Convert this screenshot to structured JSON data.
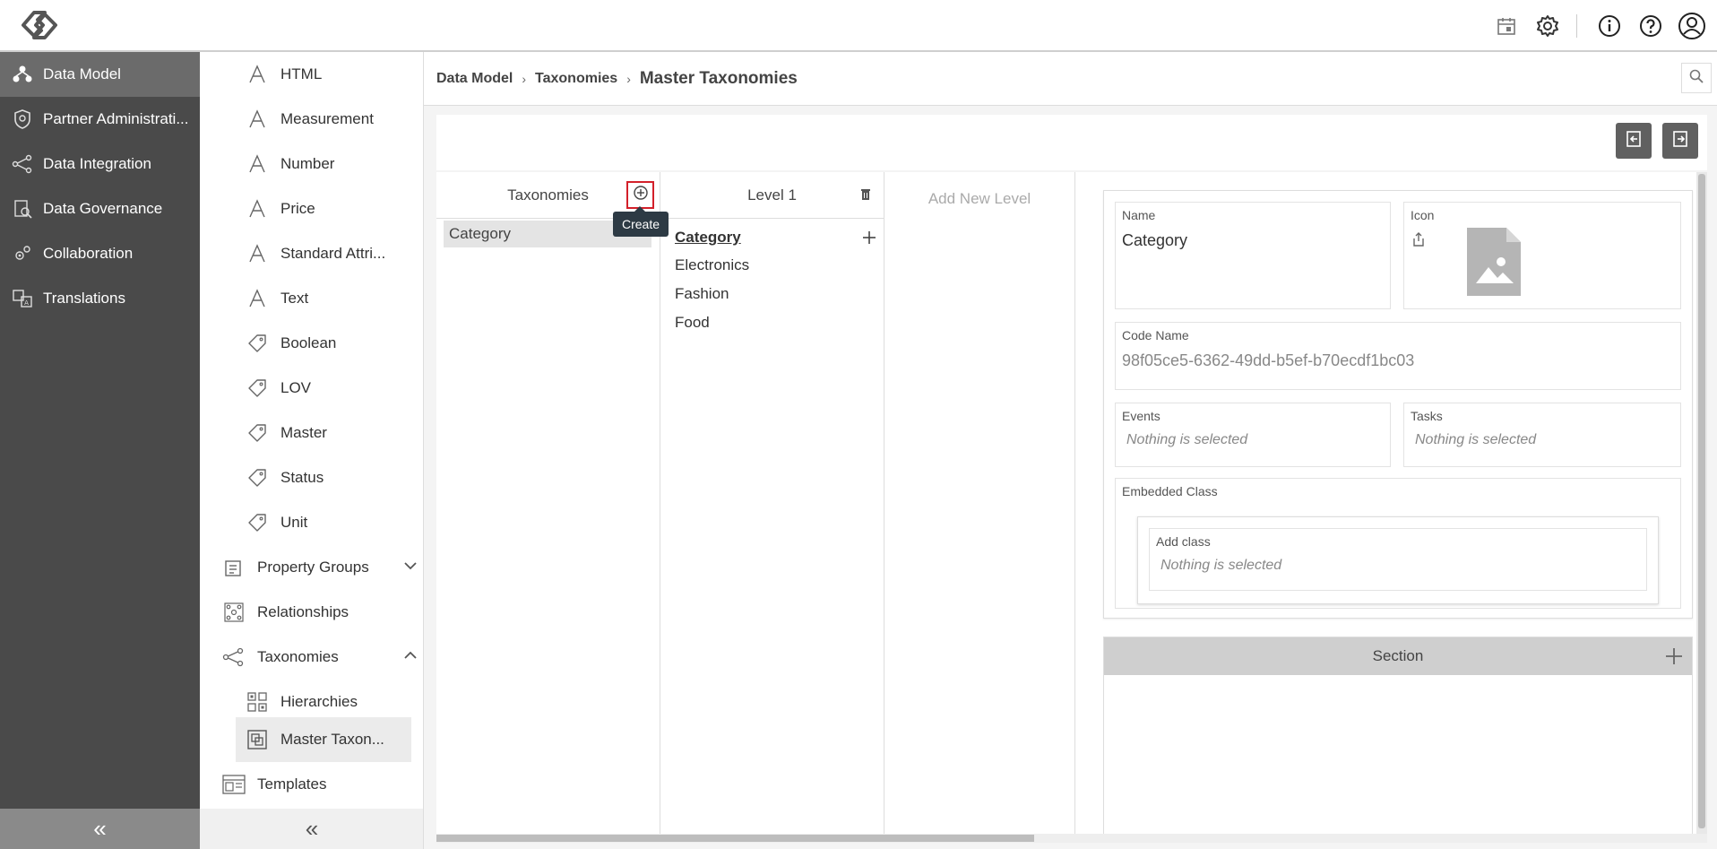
{
  "topbar": {
    "icons": [
      "calendar-icon",
      "gear-icon",
      "info-icon",
      "help-icon",
      "user-icon"
    ]
  },
  "leftnav": {
    "items": [
      {
        "label": "Data Model",
        "icon": "data-model-icon",
        "active": true
      },
      {
        "label": "Partner Administrati...",
        "icon": "shield-icon",
        "active": false
      },
      {
        "label": "Data Integration",
        "icon": "integration-icon",
        "active": false
      },
      {
        "label": "Data Governance",
        "icon": "governance-icon",
        "active": false
      },
      {
        "label": "Collaboration",
        "icon": "collaboration-icon",
        "active": false
      },
      {
        "label": "Translations",
        "icon": "translations-icon",
        "active": false
      }
    ],
    "collapse": "«"
  },
  "subnav": {
    "items": [
      {
        "label": "HTML",
        "icon": "attribute-a-icon"
      },
      {
        "label": "Measurement",
        "icon": "attribute-a-icon"
      },
      {
        "label": "Number",
        "icon": "attribute-a-icon"
      },
      {
        "label": "Price",
        "icon": "attribute-a-icon"
      },
      {
        "label": "Standard Attri...",
        "icon": "attribute-a-icon"
      },
      {
        "label": "Text",
        "icon": "attribute-a-icon"
      },
      {
        "label": "Boolean",
        "icon": "tag-icon"
      },
      {
        "label": "LOV",
        "icon": "tag-icon"
      },
      {
        "label": "Master",
        "icon": "tag-icon"
      },
      {
        "label": "Status",
        "icon": "tag-icon"
      },
      {
        "label": "Unit",
        "icon": "tag-icon"
      }
    ],
    "groups": {
      "property_groups": "Property Groups",
      "relationships": "Relationships",
      "taxonomies": "Taxonomies",
      "hierarchies": "Hierarchies",
      "master_taxonomies": "Master Taxon...",
      "templates": "Templates"
    },
    "collapse": "«"
  },
  "breadcrumb": {
    "items": [
      "Data Model",
      "Taxonomies"
    ],
    "separator": "›",
    "current": "Master Taxonomies"
  },
  "taxonomies_column": {
    "header": "Taxonomies",
    "tooltip": "Create",
    "items": [
      "Category"
    ]
  },
  "level1_column": {
    "header": "Level 1",
    "head_item": "Category",
    "items": [
      "Electronics",
      "Fashion",
      "Food"
    ]
  },
  "new_level": {
    "label": "Add New Level"
  },
  "detail": {
    "name_label": "Name",
    "name_value": "Category",
    "icon_label": "Icon",
    "code_label": "Code Name",
    "code_value": "98f05ce5-6362-49dd-b5ef-b70ecdf1bc03",
    "events_label": "Events",
    "events_value": "Nothing is selected",
    "tasks_label": "Tasks",
    "tasks_value": "Nothing is selected",
    "embedded_label": "Embedded Class",
    "add_class_label": "Add class",
    "add_class_value": "Nothing is selected",
    "section_label": "Section"
  },
  "colors": {
    "leftnav_bg": "#4a4a4a",
    "leftnav_active": "#6b6b6b",
    "create_border": "#d3202a",
    "tooltip_bg": "#2d3a44"
  }
}
